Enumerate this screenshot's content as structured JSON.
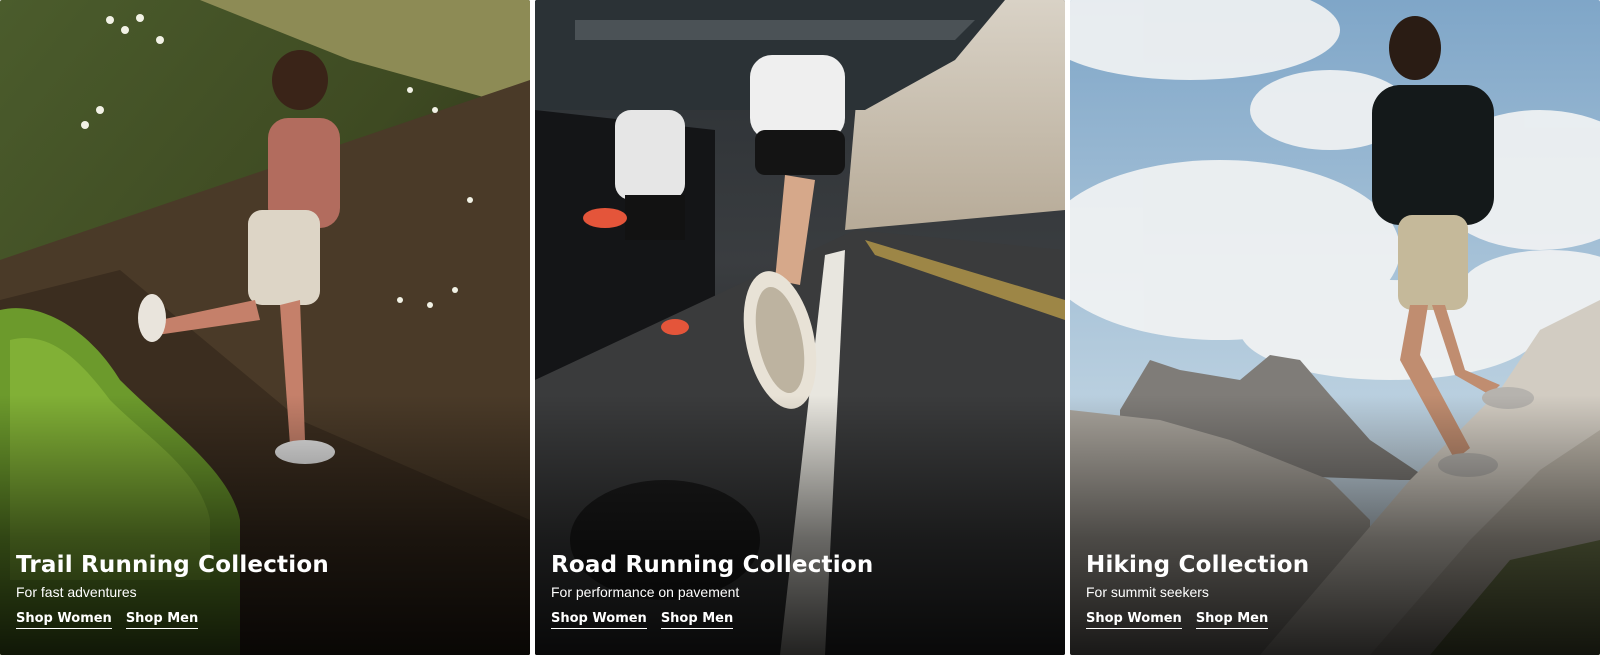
{
  "cards": [
    {
      "title": "Trail Running Collection",
      "subtitle": "For fast adventures",
      "links": [
        "Shop Women",
        "Shop Men"
      ]
    },
    {
      "title": "Road Running Collection",
      "subtitle": "For performance on pavement",
      "links": [
        "Shop Women",
        "Shop Men"
      ]
    },
    {
      "title": "Hiking Collection",
      "subtitle": "For summit seekers",
      "links": [
        "Shop Women",
        "Shop Men"
      ]
    }
  ]
}
